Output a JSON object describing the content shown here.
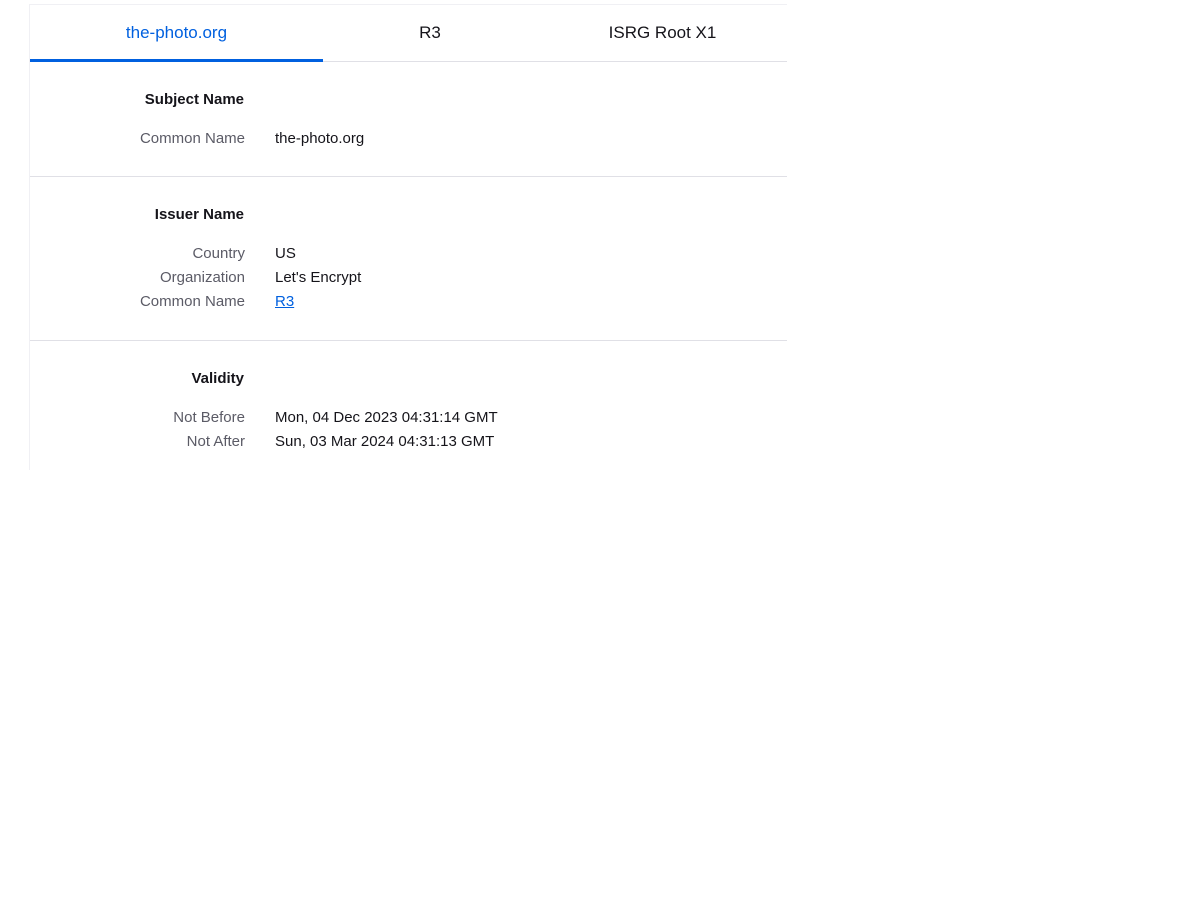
{
  "tabs": [
    {
      "label": "the-photo.org",
      "active": true
    },
    {
      "label": "R3",
      "active": false
    },
    {
      "label": "ISRG Root X1",
      "active": false
    }
  ],
  "subject": {
    "title": "Subject Name",
    "fields": [
      {
        "label": "Common Name",
        "value": "the-photo.org"
      }
    ]
  },
  "issuer": {
    "title": "Issuer Name",
    "fields": [
      {
        "label": "Country",
        "value": "US"
      },
      {
        "label": "Organization",
        "value": "Let's Encrypt"
      },
      {
        "label": "Common Name",
        "value": "R3"
      }
    ]
  },
  "validity": {
    "title": "Validity",
    "fields": [
      {
        "label": "Not Before",
        "value": "Mon, 04 Dec 2023 04:31:14 GMT"
      },
      {
        "label": "Not After",
        "value": "Sun, 03 Mar 2024 04:31:13 GMT"
      }
    ]
  },
  "colors": {
    "accent": "#0060df",
    "text": "#15141a",
    "label": "#5b5b66",
    "divider": "#e0e0e6"
  }
}
